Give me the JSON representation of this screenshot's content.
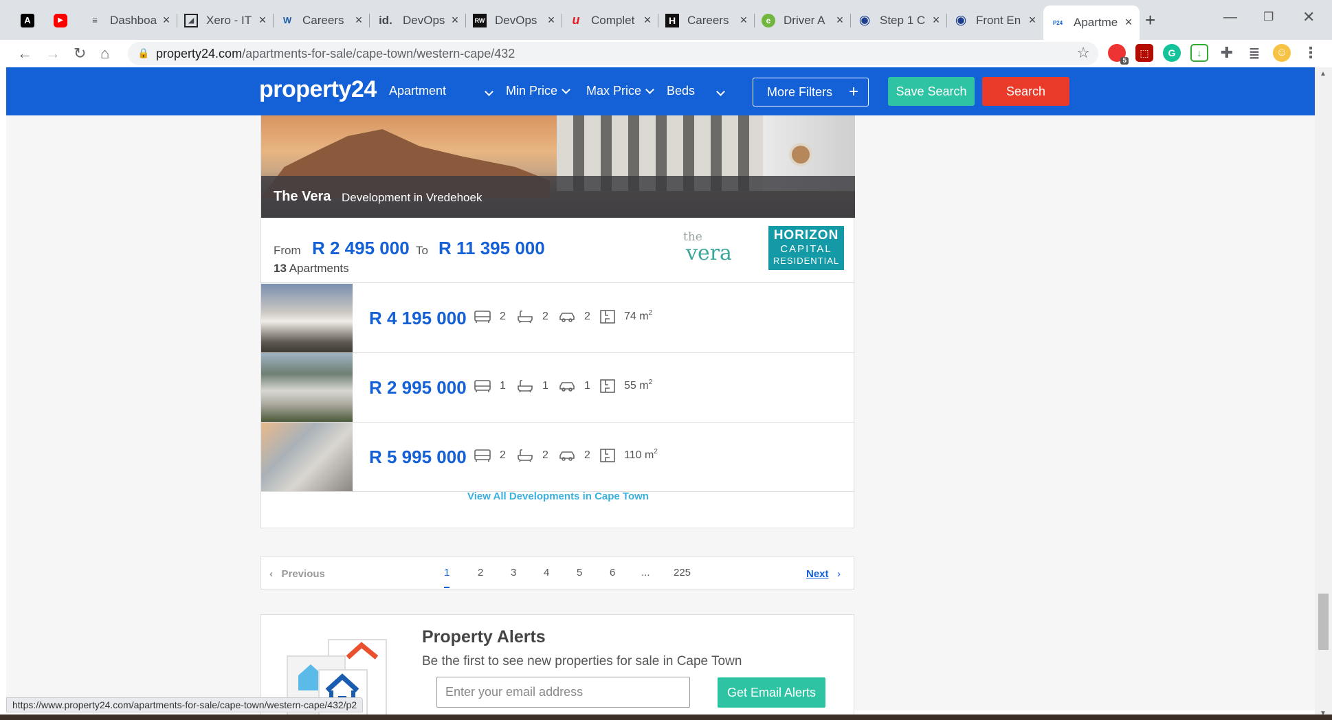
{
  "browser": {
    "tabs": [
      {
        "label": "",
        "favicon": "A",
        "color": "#000000"
      },
      {
        "label": "",
        "favicon": "▶",
        "color": "#ff0000"
      },
      {
        "label": "Dashboa",
        "favicon": "≡",
        "color": "#1c1c1c"
      },
      {
        "label": "Xero - IT",
        "favicon": "◢",
        "color": "#222222"
      },
      {
        "label": "Careers",
        "favicon": "W",
        "color": "#f2a900"
      },
      {
        "label": "DevOps",
        "favicon": "id.",
        "color": "#222222"
      },
      {
        "label": "DevOps",
        "favicon": "RW",
        "color": "#111111"
      },
      {
        "label": "Complet",
        "favicon": "u",
        "color": "#e31b23"
      },
      {
        "label": "Careers",
        "favicon": "H",
        "color": "#111111"
      },
      {
        "label": "Driver A",
        "favicon": "e",
        "color": "#71b63e"
      },
      {
        "label": "Step 1 C",
        "favicon": "◉",
        "color": "#1d3d8f"
      },
      {
        "label": "Front En",
        "favicon": "◉",
        "color": "#1d3d8f"
      },
      {
        "label": "Apartme",
        "favicon": "P24",
        "color": "#1460d6"
      }
    ],
    "url_host": "property24.com",
    "url_path": "/apartments-for-sale/cape-town/western-cape/432",
    "extension_badge": "5",
    "status_url": "https://www.property24.com/apartments-for-sale/cape-town/western-cape/432/p2"
  },
  "header": {
    "logo": "property24",
    "property_type": "Apartment",
    "min_price": "Min Price",
    "max_price": "Max Price",
    "beds": "Beds",
    "more_filters": "More Filters",
    "save_search": "Save Search",
    "search": "Search"
  },
  "development": {
    "name": "The Vera",
    "subtitle": "Development in Vredehoek",
    "from_label": "From",
    "price_from": "R 2 495 000",
    "to_label": "To",
    "price_to": "R 11 395 000",
    "apartment_count": "13",
    "apartment_label": "Apartments",
    "brand_small": "the",
    "brand_big": "vera",
    "partner_line1": "HORIZON",
    "partner_line2": "CAPITAL",
    "partner_line3": "RESIDENTIAL",
    "units": [
      {
        "price": "R 4 195 000",
        "beds": "2",
        "baths": "2",
        "parking": "2",
        "size": "74 m",
        "unit": "2"
      },
      {
        "price": "R 2 995 000",
        "beds": "1",
        "baths": "1",
        "parking": "1",
        "size": "55 m",
        "unit": "2"
      },
      {
        "price": "R 5 995 000",
        "beds": "2",
        "baths": "2",
        "parking": "2",
        "size": "110 m",
        "unit": "2"
      }
    ],
    "view_all": "View All Developments in Cape Town"
  },
  "pagination": {
    "previous": "Previous",
    "pages": [
      "1",
      "2",
      "3",
      "4",
      "5",
      "6",
      "...",
      "225"
    ],
    "current": "1",
    "next": "Next"
  },
  "alerts": {
    "title": "Property Alerts",
    "subtitle": "Be the first to see new properties for sale in",
    "location": "Cape Town",
    "email_placeholder": "Enter your email address",
    "button": "Get Email Alerts"
  },
  "colors": {
    "brand_blue": "#1460d6",
    "save_green": "#2ec4a3",
    "search_red": "#ea3b2a",
    "link_cyan": "#3ab0e2"
  }
}
